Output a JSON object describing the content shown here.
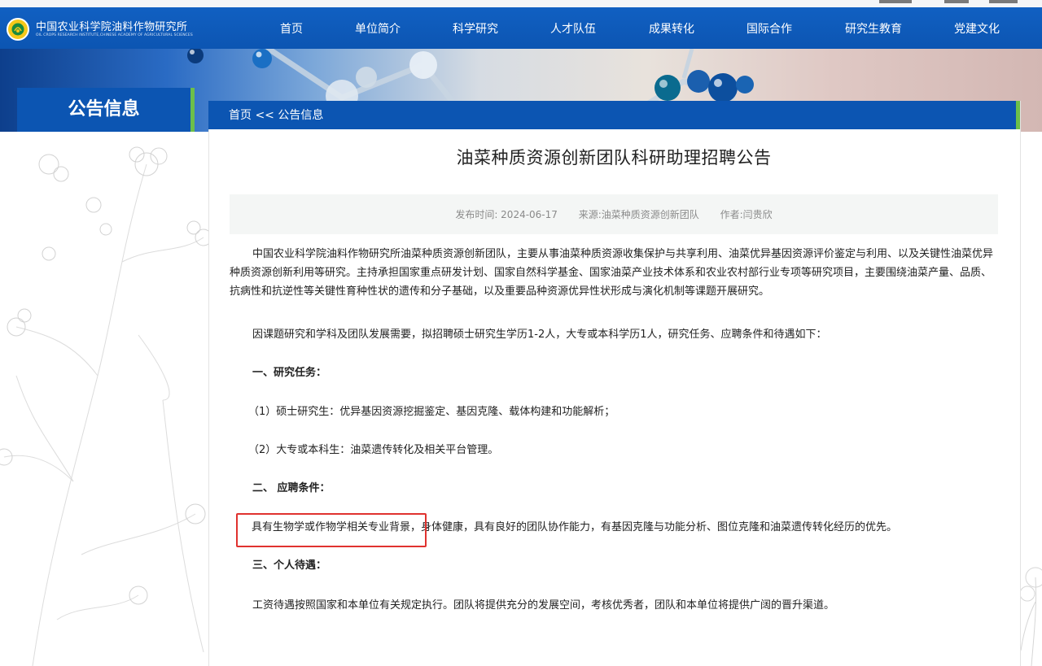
{
  "header": {
    "logo_cn": "中国农业科学院油料作物研究所",
    "logo_en": "OIL CROPS RESEARCH INSTITUTE,CHINESE ACADEMY OF AGRICULTURAL SCIENCES"
  },
  "nav": {
    "items": [
      {
        "label": "首页"
      },
      {
        "label": "单位简介"
      },
      {
        "label": "科学研究"
      },
      {
        "label": "人才队伍"
      },
      {
        "label": "成果转化"
      },
      {
        "label": "国际合作"
      },
      {
        "label": "研究生教育"
      },
      {
        "label": "党建文化"
      }
    ]
  },
  "sidebar": {
    "title": "公告信息"
  },
  "breadcrumb": {
    "home": "首页",
    "separator": " << ",
    "current": "公告信息"
  },
  "article": {
    "title": "油菜种质资源创新团队科研助理招聘公告",
    "meta": {
      "published": "发布时间: 2024-06-17",
      "source": "来源:油菜种质资源创新团队",
      "author": "作者:闫贵欣"
    },
    "intro": "中国农业科学院油料作物研究所油菜种质资源创新团队，主要从事油菜种质资源收集保护与共享利用、油菜优异基因资源评价鉴定与利用、以及关键性油菜优异种质资源创新利用等研究。主持承担国家重点研发计划、国家自然科学基金、国家油菜产业技术体系和农业农村部行业专项等研究项目，主要围绕油菜产量、品质、抗病性和抗逆性等关键性育种性状的遗传和分子基础，以及重要品种资源优异性状形成与演化机制等课题开展研究。",
    "recruit": "因课题研究和学科及团队发展需要，拟招聘硕士研究生学历1-2人，大专或本科学历1人，研究任务、应聘条件和待遇如下：",
    "section1_title": "一、研究任务：",
    "task1": "（1）硕士研究生：优异基因资源挖掘鉴定、基因克隆、载体构建和功能解析；",
    "task2": "（2）大专或本科生：油菜遗传转化及相关平台管理。",
    "section2_title": "二、 应聘条件：",
    "conditions": "具有生物学或作物学相关专业背景，身体健康，具有良好的团队协作能力，有基因克隆与功能分析、图位克隆和油菜遗传转化经历的优先。",
    "section3_title": "三、个人待遇：",
    "benefits": "工资待遇按照国家和本单位有关规定执行。团队将提供充分的发展空间，考核优秀者，团队和本单位将提供广阔的晋升渠道。"
  },
  "colors": {
    "nav_blue": "#0c55b2",
    "accent_green": "#6cbf4a",
    "highlight_red": "#e0322f",
    "meta_bg": "#f4f6f5"
  }
}
